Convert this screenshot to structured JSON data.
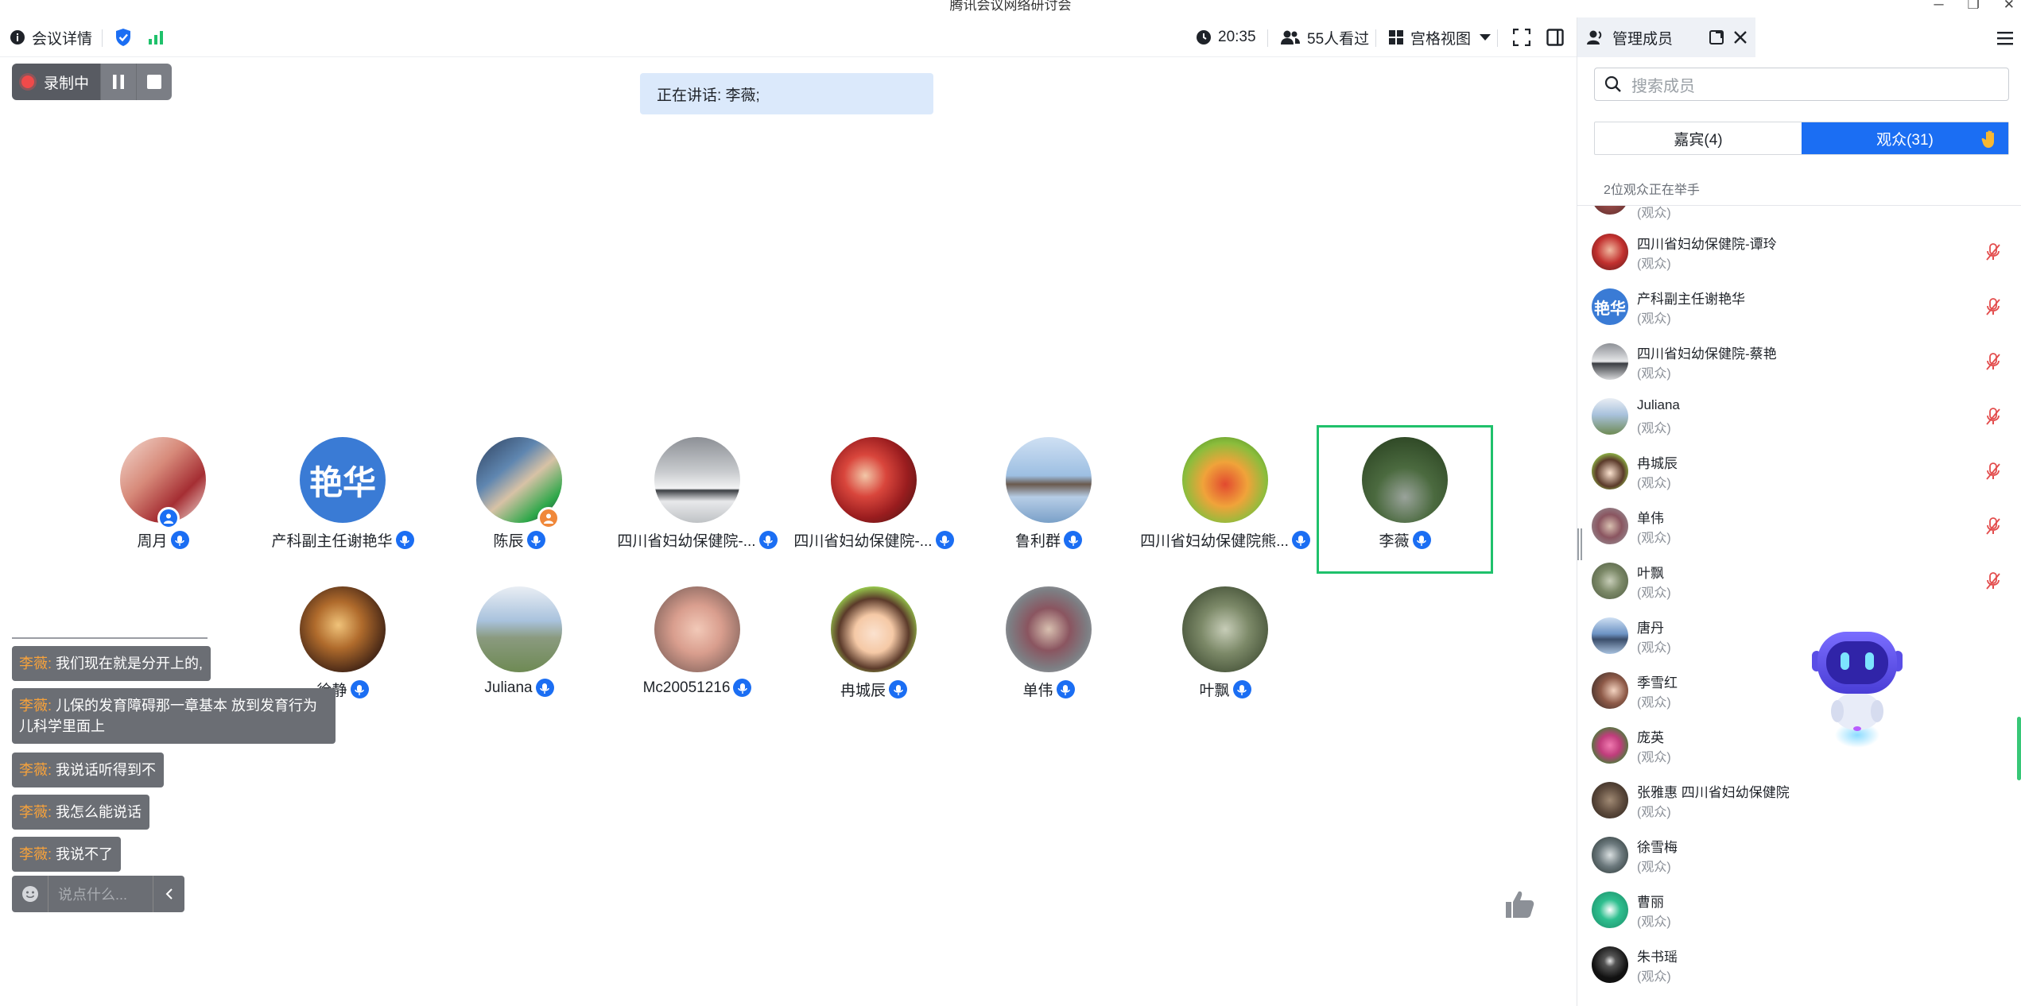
{
  "window": {
    "title": "腾讯会议网络研讨会"
  },
  "toolbar": {
    "meeting_info": "会议详情",
    "time": "20:35",
    "viewers": "55人看过",
    "view_mode": "宫格视图"
  },
  "recording": {
    "label": "录制中"
  },
  "speaking_banner": "正在讲话: 李薇;",
  "participants_row1": [
    {
      "name": "周月"
    },
    {
      "name": "产科副主任谢艳华",
      "avatar_text": "艳华"
    },
    {
      "name": "陈辰"
    },
    {
      "name": "四川省妇幼保健院-..."
    },
    {
      "name": "四川省妇幼保健院-..."
    },
    {
      "name": "鲁利群"
    },
    {
      "name": "四川省妇幼保健院熊..."
    },
    {
      "name": "李薇"
    }
  ],
  "participants_row2": [
    {
      "name": "徐静"
    },
    {
      "name": "Juliana"
    },
    {
      "name": "Mc20051216"
    },
    {
      "name": "冉城辰"
    },
    {
      "name": "单伟"
    },
    {
      "name": "叶飘"
    }
  ],
  "chat": {
    "messages": [
      {
        "who": "李薇:",
        "text": "我们现在就是分开上的,",
        "lines": [
          "我们现在就是分开上的,"
        ]
      },
      {
        "who": "李薇:",
        "text": "儿保的发育障碍那一章基本 放到发育行为",
        "text2": "儿科学里面上"
      },
      {
        "who": "李薇:",
        "text": "我说话听得到不"
      },
      {
        "who": "李薇:",
        "text": "我怎么能说话"
      },
      {
        "who": "李薇:",
        "text": "我说不了"
      }
    ],
    "input_placeholder": "说点什么..."
  },
  "panel": {
    "title": "管理成员",
    "search_placeholder": "搜索成员",
    "tab_guests": "嘉宾(4)",
    "tab_audience": "观众(31)",
    "raise_note": "2位观众正在举手",
    "partial_role": "(观众)",
    "members": [
      {
        "name": "四川省妇幼保健院-谭玲",
        "role": "(观众)",
        "muted": true
      },
      {
        "name": "产科副主任谢艳华",
        "role": "(观众)",
        "muted": true,
        "avatar_text": "艳华"
      },
      {
        "name": "四川省妇幼保健院-蔡艳",
        "role": "(观众)",
        "muted": true
      },
      {
        "name": "Juliana",
        "role": "(观众)",
        "muted": true
      },
      {
        "name": "冉城辰",
        "role": "(观众)",
        "muted": true
      },
      {
        "name": "单伟",
        "role": "(观众)",
        "muted": true
      },
      {
        "name": "叶飘",
        "role": "(观众)",
        "muted": true
      },
      {
        "name": "唐丹",
        "role": "(观众)",
        "muted": false
      },
      {
        "name": "季雪红",
        "role": "(观众)",
        "muted": false
      },
      {
        "name": "庞英",
        "role": "(观众)",
        "muted": false
      },
      {
        "name": "张雅惠 四川省妇幼保健院",
        "role": "(观众)",
        "muted": false
      },
      {
        "name": "徐雪梅",
        "role": "(观众)",
        "muted": false
      },
      {
        "name": "曹丽",
        "role": "(观众)",
        "muted": false
      },
      {
        "name": "朱书瑶",
        "role": "(观众)",
        "muted": false
      }
    ]
  },
  "colors": {
    "accent": "#1b6ef3",
    "selected_border": "#1fc16b",
    "chat_name": "#f7a23b",
    "rec_red": "#f04a4a"
  }
}
